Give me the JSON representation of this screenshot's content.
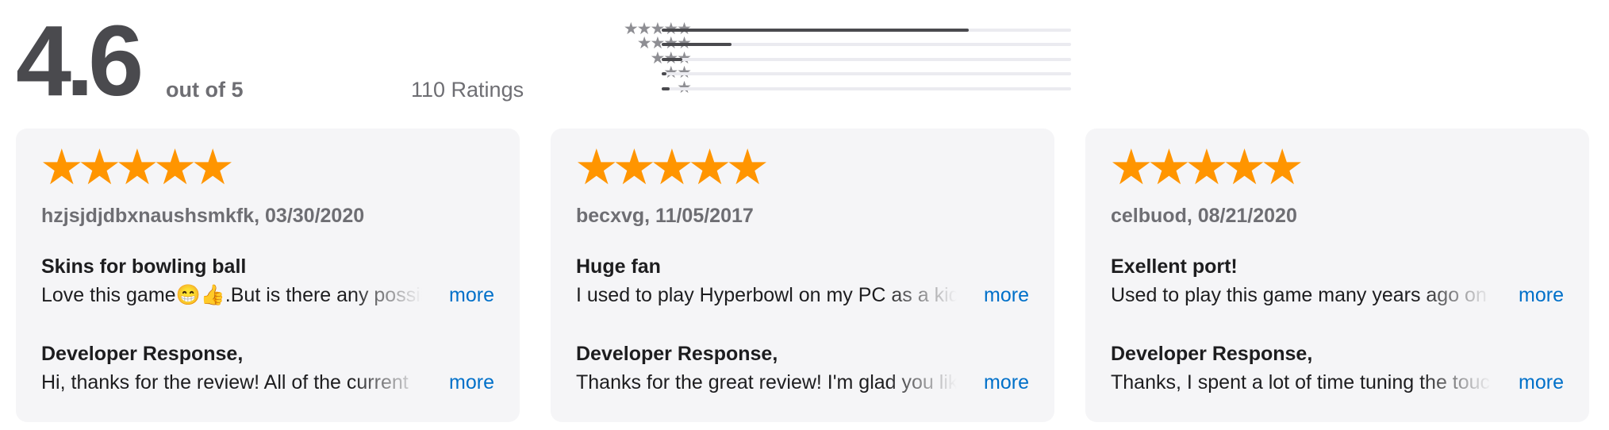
{
  "summary": {
    "average": "4.6",
    "out_of": "out of 5",
    "ratings_count": "110 Ratings",
    "histogram": [
      {
        "stars": "★★★★★",
        "fraction": 0.75
      },
      {
        "stars": "★★★★",
        "fraction": 0.17
      },
      {
        "stars": "★★★",
        "fraction": 0.05
      },
      {
        "stars": "★★",
        "fraction": 0.01
      },
      {
        "stars": "★",
        "fraction": 0.02
      }
    ]
  },
  "reviews": [
    {
      "stars": "★★★★★",
      "meta": "hzjsjdjdbxnaushsmkfk, 03/30/2020",
      "title": "Skins for bowling ball",
      "body": "Love this game😁👍.But is there any possibility",
      "dev_title": "Developer Response,",
      "dev_body": "Hi, thanks for the review! All of the current",
      "more": "more"
    },
    {
      "stars": "★★★★★",
      "meta": "becxvg, 11/05/2017",
      "title": "Huge fan",
      "body": "I used to play Hyperbowl on my PC as a kid",
      "dev_title": "Developer Response,",
      "dev_body": "Thanks for the great review! I'm glad you like",
      "more": "more"
    },
    {
      "stars": "★★★★★",
      "meta": "celbuod, 08/21/2020",
      "title": "Exellent port!",
      "body": "Used to play this game many years ago on",
      "dev_title": "Developer Response,",
      "dev_body": "Thanks, I spent a lot of time tuning the touch",
      "more": "more"
    }
  ],
  "colors": {
    "star": "#ff9500",
    "link": "#0070c9",
    "card_bg": "#f5f5f7"
  }
}
